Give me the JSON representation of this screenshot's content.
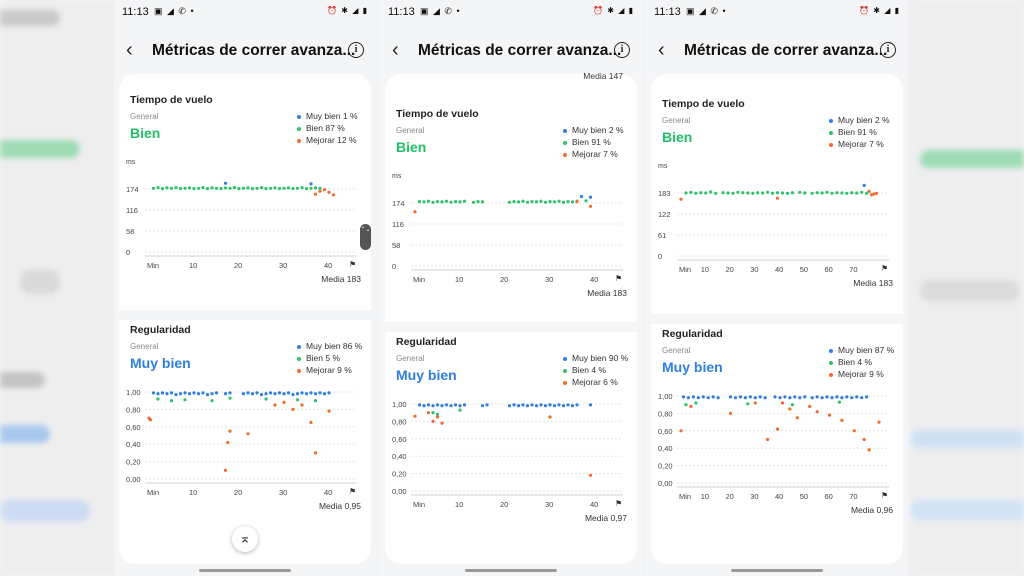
{
  "colors": {
    "muy_bien": "#2f7fe0",
    "bien": "#2ec36a",
    "mejorar": "#f26a2e",
    "rating_bien": "#22c066",
    "rating_muy_bien": "#2f7fe0"
  },
  "panels": [
    {
      "status_time": "11:13",
      "title": "Métricas de correr avanza...",
      "top_media": "",
      "vuelo": {
        "label": "Tiempo de vuelo",
        "general": "General",
        "rating": "Bien",
        "legend": [
          "Muy bien 1 %",
          "Bien 87 %",
          "Mejorar 12 %"
        ],
        "unit": "ms",
        "yticks": [
          "174",
          "116",
          "58",
          "0"
        ],
        "xticks": [
          "Min",
          "10",
          "20",
          "30",
          "40"
        ],
        "media": "Media 183",
        "chart_data": {
          "type": "scatter",
          "ylim": [
            0,
            232
          ],
          "xmax": 44,
          "points": [
            {
              "c": "bien",
              "x": [
                1,
                2,
                3,
                4,
                5,
                6,
                7,
                8,
                9,
                10,
                11,
                12,
                13,
                14,
                15,
                16,
                17,
                18,
                19,
                20,
                21,
                22,
                23,
                24,
                25,
                26,
                27,
                28,
                29,
                30,
                31,
                32,
                33,
                34,
                35,
                36,
                37,
                38
              ],
              "y": [
                176,
                178,
                175,
                177,
                176,
                178,
                175,
                176,
                177,
                175,
                176,
                178,
                175,
                177,
                176,
                175,
                177,
                176,
                178,
                175,
                176,
                177,
                175,
                176,
                178,
                175,
                176,
                177,
                175,
                176,
                177,
                175,
                176,
                178,
                175,
                176,
                177,
                176
              ]
            },
            {
              "c": "muy_bien",
              "x": [
                17,
                36
              ],
              "y": [
                190,
                188
              ]
            },
            {
              "c": "mejorar",
              "x": [
                37,
                38,
                39,
                40,
                41
              ],
              "y": [
                160,
                168,
                172,
                165,
                158
              ]
            }
          ]
        }
      },
      "regularidad": {
        "label": "Regularidad",
        "general": "General",
        "rating": "Muy bien",
        "legend": [
          "Muy bien 86 %",
          "Bien 5 %",
          "Mejorar 9 %"
        ],
        "yticks": [
          "1,00",
          "0,80",
          "0,60",
          "0,40",
          "0,20",
          "0,00"
        ],
        "xticks": [
          "Min",
          "10",
          "20",
          "30",
          "40"
        ],
        "media": "Media 0,95",
        "chart_data": {
          "type": "scatter",
          "ylim": [
            0,
            1
          ],
          "xmax": 44,
          "points": [
            {
              "c": "muy_bien",
              "x": [
                1,
                2,
                3,
                4,
                5,
                6,
                7,
                8,
                9,
                10,
                11,
                12,
                13,
                14,
                15,
                17,
                18,
                21,
                22,
                23,
                24,
                25,
                26,
                27,
                28,
                29,
                30,
                31,
                32,
                33,
                34,
                35,
                36,
                37,
                38,
                39,
                40
              ],
              "y": [
                0.99,
                0.98,
                0.99,
                0.98,
                0.99,
                0.97,
                0.98,
                0.99,
                0.98,
                0.99,
                0.98,
                0.99,
                0.97,
                0.98,
                0.99,
                0.98,
                0.99,
                0.98,
                0.99,
                0.98,
                0.99,
                0.97,
                0.98,
                0.99,
                0.98,
                0.99,
                0.98,
                0.99,
                0.97,
                0.98,
                0.99,
                0.98,
                0.99,
                0.98,
                0.99,
                0.98,
                0.99
              ]
            },
            {
              "c": "bien",
              "x": [
                2,
                5,
                8,
                14,
                18,
                26,
                33,
                37
              ],
              "y": [
                0.92,
                0.9,
                0.91,
                0.9,
                0.93,
                0.92,
                0.91,
                0.9
              ]
            },
            {
              "c": "mejorar",
              "x": [
                0,
                0.3,
                17,
                17.5,
                18,
                22,
                28,
                30,
                32,
                34,
                36,
                37,
                40
              ],
              "y": [
                0.7,
                0.68,
                0.1,
                0.42,
                0.55,
                0.52,
                0.85,
                0.88,
                0.8,
                0.85,
                0.65,
                0.3,
                0.78
              ]
            }
          ]
        }
      }
    },
    {
      "status_time": "11:13",
      "title": "Métricas de correr avanza...",
      "top_media": "Media 147",
      "vuelo": {
        "label": "Tiempo de vuelo",
        "general": "General",
        "rating": "Bien",
        "legend": [
          "Muy bien 2 %",
          "Bien 91 %",
          "Mejorar 7 %"
        ],
        "unit": "ms",
        "yticks": [
          "174",
          "116",
          "58",
          "0"
        ],
        "xticks": [
          "Min",
          "10",
          "20",
          "30",
          "40"
        ],
        "media": "Media 183",
        "chart_data": {
          "type": "scatter",
          "ylim": [
            0,
            232
          ],
          "xmax": 44,
          "points": [
            {
              "c": "bien",
              "x": [
                1,
                2,
                3,
                4,
                5,
                6,
                7,
                8,
                9,
                10,
                11,
                13,
                14,
                15,
                21,
                22,
                23,
                24,
                25,
                26,
                27,
                28,
                29,
                30,
                31,
                32,
                33,
                34,
                35,
                36,
                38
              ],
              "y": [
                178,
                177,
                179,
                176,
                178,
                177,
                179,
                176,
                178,
                177,
                179,
                176,
                178,
                177,
                176,
                178,
                177,
                179,
                176,
                178,
                177,
                179,
                176,
                178,
                177,
                179,
                176,
                178,
                177,
                179,
                180
              ]
            },
            {
              "c": "muy_bien",
              "x": [
                37,
                39
              ],
              "y": [
                192,
                190
              ]
            },
            {
              "c": "mejorar",
              "x": [
                0,
                36,
                39
              ],
              "y": [
                150,
                178,
                165
              ]
            }
          ]
        }
      },
      "regularidad": {
        "label": "Regularidad",
        "general": "General",
        "rating": "Muy bien",
        "legend": [
          "Muy bien 90 %",
          "Bien 4 %",
          "Mejorar 6 %"
        ],
        "yticks": [
          "1,00",
          "0,80",
          "0,60",
          "0,40",
          "0,20",
          "0,00"
        ],
        "xticks": [
          "Min",
          "10",
          "20",
          "30",
          "40"
        ],
        "media": "Media 0,97",
        "chart_data": {
          "type": "scatter",
          "ylim": [
            0,
            1
          ],
          "xmax": 44,
          "points": [
            {
              "c": "muy_bien",
              "x": [
                1,
                2,
                3,
                4,
                5,
                6,
                7,
                8,
                9,
                10,
                11,
                15,
                16,
                21,
                22,
                23,
                24,
                25,
                26,
                27,
                28,
                29,
                30,
                31,
                32,
                33,
                34,
                35,
                36,
                39
              ],
              "y": [
                0.99,
                0.98,
                0.99,
                0.98,
                0.99,
                0.98,
                0.99,
                0.98,
                0.99,
                0.98,
                0.99,
                0.98,
                0.99,
                0.98,
                0.99,
                0.98,
                0.99,
                0.98,
                0.99,
                0.98,
                0.99,
                0.98,
                0.99,
                0.98,
                0.99,
                0.98,
                0.99,
                0.98,
                0.99,
                0.99
              ]
            },
            {
              "c": "bien",
              "x": [
                4,
                5,
                10
              ],
              "y": [
                0.9,
                0.88,
                0.93
              ]
            },
            {
              "c": "mejorar",
              "x": [
                0,
                3,
                4,
                5,
                6,
                30,
                39
              ],
              "y": [
                0.86,
                0.9,
                0.8,
                0.85,
                0.78,
                0.85,
                0.18
              ]
            }
          ]
        }
      }
    },
    {
      "status_time": "11:13",
      "title": "Métricas de correr avanza...",
      "top_media": "",
      "vuelo": {
        "label": "Tiempo de vuelo",
        "general": "General",
        "rating": "Bien",
        "legend": [
          "Muy bien 2 %",
          "Bien 91 %",
          "Mejorar 7 %"
        ],
        "unit": "ms",
        "yticks": [
          "183",
          "122",
          "61",
          "0"
        ],
        "xticks": [
          "Min",
          "10",
          "20",
          "30",
          "40",
          "50",
          "60",
          "70"
        ],
        "media": "Media 183",
        "chart_data": {
          "type": "scatter",
          "ylim": [
            0,
            244
          ],
          "xmax": 80,
          "points": [
            {
              "c": "bien",
              "x": [
                2,
                4,
                6,
                8,
                10,
                12,
                14,
                17,
                19,
                21,
                23,
                25,
                27,
                29,
                31,
                33,
                35,
                37,
                39,
                41,
                43,
                45,
                48,
                50,
                53,
                55,
                57,
                59,
                61,
                63,
                65,
                67,
                69,
                71,
                73,
                75
              ],
              "y": [
                183,
                185,
                182,
                184,
                183,
                186,
                182,
                184,
                183,
                182,
                185,
                184,
                183,
                182,
                184,
                183,
                185,
                182,
                184,
                183,
                182,
                184,
                185,
                183,
                182,
                184,
                183,
                185,
                182,
                184,
                183,
                182,
                184,
                183,
                185,
                182
              ]
            },
            {
              "c": "muy_bien",
              "x": [
                74
              ],
              "y": [
                205
              ]
            },
            {
              "c": "mejorar",
              "x": [
                0,
                39,
                76,
                77,
                78,
                79
              ],
              "y": [
                165,
                168,
                188,
                178,
                180,
                182
              ]
            }
          ]
        }
      },
      "regularidad": {
        "label": "Regularidad",
        "general": "General",
        "rating": "Muy bien",
        "legend": [
          "Muy bien 87 %",
          "Bien 4 %",
          "Mejorar 9 %"
        ],
        "yticks": [
          "1,00",
          "0,80",
          "0,60",
          "0,40",
          "0,20",
          "0,00"
        ],
        "xticks": [
          "Min",
          "10",
          "20",
          "30",
          "40",
          "50",
          "60",
          "70"
        ],
        "media": "Media 0,96",
        "chart_data": {
          "type": "scatter",
          "ylim": [
            0,
            1
          ],
          "xmax": 80,
          "points": [
            {
              "c": "muy_bien",
              "x": [
                1,
                3,
                5,
                7,
                9,
                11,
                13,
                15,
                20,
                22,
                24,
                26,
                28,
                30,
                32,
                34,
                38,
                40,
                42,
                44,
                46,
                48,
                50,
                53,
                55,
                57,
                59,
                61,
                63,
                65,
                67,
                69,
                71,
                73,
                75
              ],
              "y": [
                0.99,
                0.98,
                0.99,
                0.98,
                0.99,
                0.98,
                0.99,
                0.98,
                0.99,
                0.98,
                0.99,
                0.98,
                0.99,
                0.98,
                0.99,
                0.98,
                0.99,
                0.98,
                0.99,
                0.98,
                0.99,
                0.98,
                0.99,
                0.98,
                0.99,
                0.98,
                0.99,
                0.98,
                0.99,
                0.98,
                0.99,
                0.98,
                0.99,
                0.98,
                0.99
              ]
            },
            {
              "c": "bien",
              "x": [
                2,
                6,
                27,
                45,
                64
              ],
              "y": [
                0.9,
                0.92,
                0.91,
                0.9,
                0.93
              ]
            },
            {
              "c": "mejorar",
              "x": [
                0,
                4,
                20,
                30,
                35,
                39,
                41,
                44,
                47,
                52,
                55,
                60,
                65,
                70,
                74,
                76,
                80
              ],
              "y": [
                0.6,
                0.88,
                0.8,
                0.92,
                0.5,
                0.62,
                0.92,
                0.85,
                0.75,
                0.88,
                0.82,
                0.78,
                0.72,
                0.6,
                0.5,
                0.38,
                0.7
              ]
            }
          ]
        }
      }
    }
  ]
}
